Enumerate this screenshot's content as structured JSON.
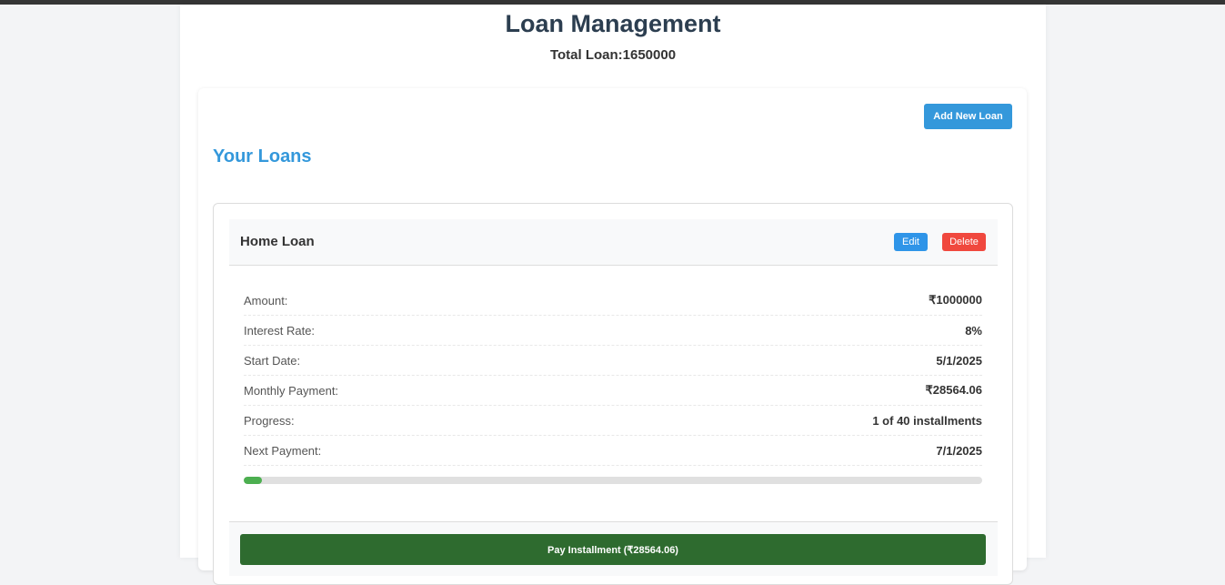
{
  "header": {
    "title": "Loan Management",
    "total_loan": "Total Loan:1650000"
  },
  "toolbar": {
    "add_label": "Add New Loan"
  },
  "section": {
    "title": "Your Loans"
  },
  "loan": {
    "name": "Home Loan",
    "edit_label": "Edit",
    "delete_label": "Delete",
    "details": [
      {
        "label": "Amount:",
        "value": "₹1000000"
      },
      {
        "label": "Interest Rate:",
        "value": "8%"
      },
      {
        "label": "Start Date:",
        "value": "5/1/2025"
      },
      {
        "label": "Monthly Payment:",
        "value": "₹28564.06"
      },
      {
        "label": "Progress:",
        "value": "1 of 40 installments"
      },
      {
        "label": "Next Payment:",
        "value": "7/1/2025"
      }
    ],
    "progress": {
      "paid": 1,
      "total": 40,
      "percent": 2.5
    },
    "pay_label": "Pay Installment (₹28564.06)"
  },
  "colors": {
    "primary": "#3498db",
    "danger": "#f0483e",
    "success": "#2e6b2f",
    "progress": "#4caf50"
  }
}
